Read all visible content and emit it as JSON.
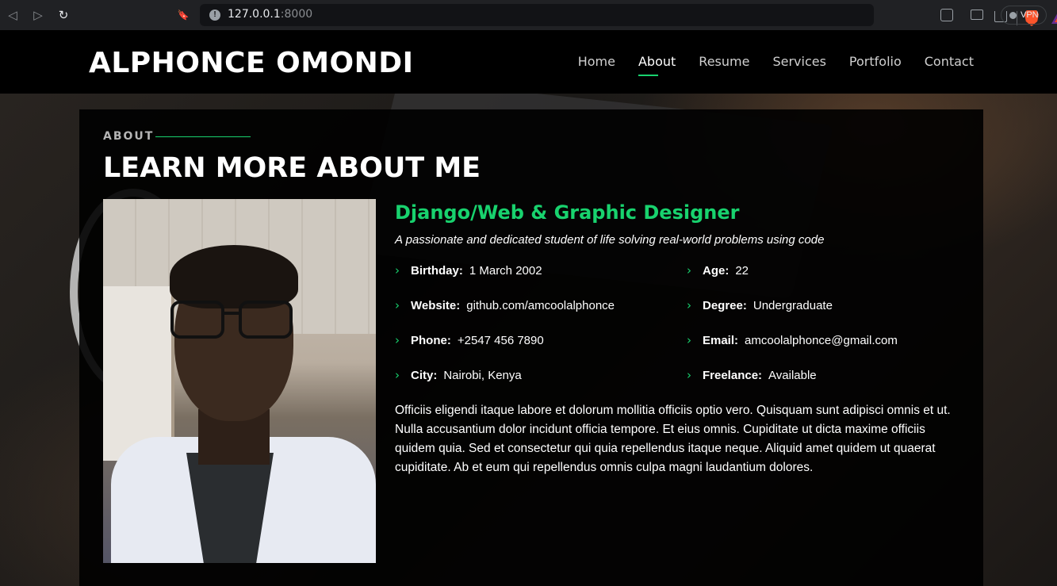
{
  "browser": {
    "url_host": "127.0.0.1",
    "url_port": ":8000",
    "vpn_label": "VPN",
    "back_icon": "◁",
    "forward_icon": "▷",
    "reload_icon": "↻",
    "bookmark_icon": "🔖",
    "info_icon": "!"
  },
  "header": {
    "logo": "ALPHONCE OMONDI",
    "nav": [
      {
        "label": "Home"
      },
      {
        "label": "About"
      },
      {
        "label": "Resume"
      },
      {
        "label": "Services"
      },
      {
        "label": "Portfolio"
      },
      {
        "label": "Contact"
      }
    ],
    "active_nav": "About"
  },
  "about": {
    "label": "ABOUT",
    "title": "LEARN MORE ABOUT ME",
    "role": "Django/Web & Graphic Designer",
    "tagline": "A passionate and dedicated student of life solving real-world problems using code",
    "facts": [
      {
        "key": "Birthday:",
        "value": "1 March 2002"
      },
      {
        "key": "Age:",
        "value": "22"
      },
      {
        "key": "Website:",
        "value": "github.com/amcoolalphonce"
      },
      {
        "key": "Degree:",
        "value": "Undergraduate"
      },
      {
        "key": "Phone:",
        "value": "+2547 456 7890"
      },
      {
        "key": "Email:",
        "value": "amcoolalphonce@gmail.com"
      },
      {
        "key": "City:",
        "value": "Nairobi, Kenya"
      },
      {
        "key": "Freelance:",
        "value": "Available"
      }
    ],
    "chevron": "›",
    "bio": "Officiis eligendi itaque labore et dolorum mollitia officiis optio vero. Quisquam sunt adipisci omnis et ut. Nulla accusantium dolor incidunt officia tempore. Et eius omnis. Cupiditate ut dicta maxime officiis quidem quia. Sed et consectetur qui quia repellendus itaque neque. Aliquid amet quidem ut quaerat cupiditate. Ab et eum qui repellendus omnis culpa magni laudantium dolores."
  },
  "colors": {
    "accent": "#18d26e",
    "header_bg": "#000000",
    "section_bg": "#000000"
  }
}
